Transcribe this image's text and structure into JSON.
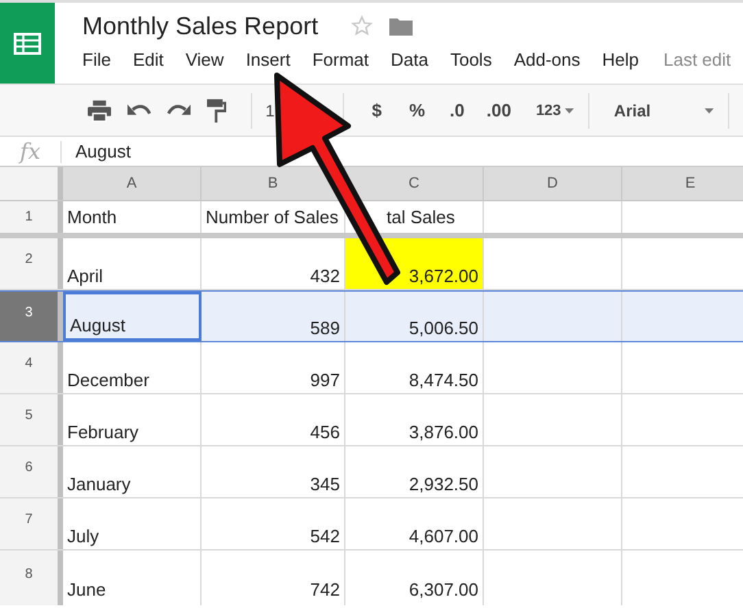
{
  "app": {
    "title": "Monthly Sales Report",
    "menu": [
      "File",
      "Edit",
      "View",
      "Insert",
      "Format",
      "Data",
      "Tools",
      "Add-ons",
      "Help"
    ],
    "last_edit": "Last edit"
  },
  "toolbar": {
    "zoom": "1",
    "currency": "$",
    "percent": "%",
    "decrease_decimals": ".0",
    "increase_decimals": ".00",
    "number_format": "123",
    "font": "Arial"
  },
  "formula_bar": {
    "label": "fx",
    "value": "August"
  },
  "sheet": {
    "columns": [
      "A",
      "B",
      "C",
      "D",
      "E"
    ],
    "rows": [
      {
        "number": "1",
        "selected": false,
        "kind": "header",
        "cells": [
          {
            "text": "Month",
            "highlight": false
          },
          {
            "text": "Number of Sales",
            "highlight": false
          },
          {
            "text": "tal Sales",
            "highlight": false
          }
        ]
      },
      {
        "number": "2",
        "selected": false,
        "kind": "data",
        "cells": [
          {
            "text": "April",
            "highlight": false
          },
          {
            "text": "432",
            "highlight": false
          },
          {
            "text": "3,672.00",
            "highlight": true
          }
        ]
      },
      {
        "number": "3",
        "selected": true,
        "kind": "data",
        "cells": [
          {
            "text": "August",
            "highlight": false
          },
          {
            "text": "589",
            "highlight": false
          },
          {
            "text": "5,006.50",
            "highlight": false
          }
        ]
      },
      {
        "number": "4",
        "selected": false,
        "kind": "data",
        "cells": [
          {
            "text": "December",
            "highlight": false
          },
          {
            "text": "997",
            "highlight": false
          },
          {
            "text": "8,474.50",
            "highlight": false
          }
        ]
      },
      {
        "number": "5",
        "selected": false,
        "kind": "data",
        "cells": [
          {
            "text": "February",
            "highlight": false
          },
          {
            "text": "456",
            "highlight": false
          },
          {
            "text": "3,876.00",
            "highlight": false
          }
        ]
      },
      {
        "number": "6",
        "selected": false,
        "kind": "data",
        "cells": [
          {
            "text": "January",
            "highlight": false
          },
          {
            "text": "345",
            "highlight": false
          },
          {
            "text": "2,932.50",
            "highlight": false
          }
        ]
      },
      {
        "number": "7",
        "selected": false,
        "kind": "data",
        "cells": [
          {
            "text": "July",
            "highlight": false
          },
          {
            "text": "542",
            "highlight": false
          },
          {
            "text": "4,607.00",
            "highlight": false
          }
        ]
      },
      {
        "number": "8",
        "selected": false,
        "kind": "data",
        "cells": [
          {
            "text": "June",
            "highlight": false
          },
          {
            "text": "742",
            "highlight": false
          },
          {
            "text": "6,307.00",
            "highlight": false
          }
        ]
      }
    ]
  }
}
